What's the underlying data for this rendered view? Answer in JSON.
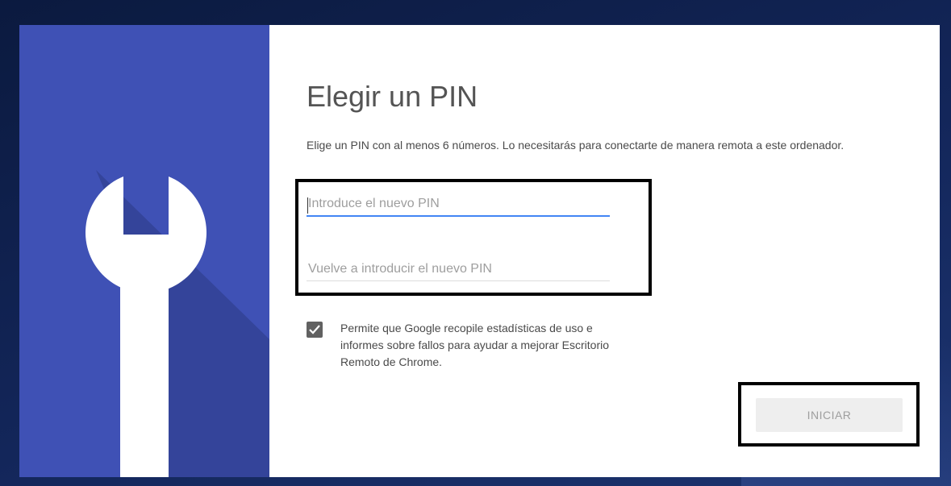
{
  "dialog": {
    "title": "Elegir un PIN",
    "description": "Elige un PIN con al menos 6 números. Lo necesitarás para conectarte de manera remota a este ordenador.",
    "illustration_icon": "wrench-icon"
  },
  "pin_form": {
    "new_pin_placeholder": "Introduce el nuevo PIN",
    "new_pin_value": "",
    "confirm_pin_placeholder": "Vuelve a introducir el nuevo PIN",
    "confirm_pin_value": ""
  },
  "consent": {
    "checked": true,
    "label": "Permite que Google recopile estadísticas de uso e informes sobre fallos para ayudar a mejorar Escritorio Remoto de Chrome."
  },
  "actions": {
    "start_label": "INICIAR"
  },
  "colors": {
    "panel_blue": "#3f51b5",
    "focus_blue": "#4285f4",
    "backdrop_navy": "#13265a",
    "checkbox_gray": "#616161"
  }
}
